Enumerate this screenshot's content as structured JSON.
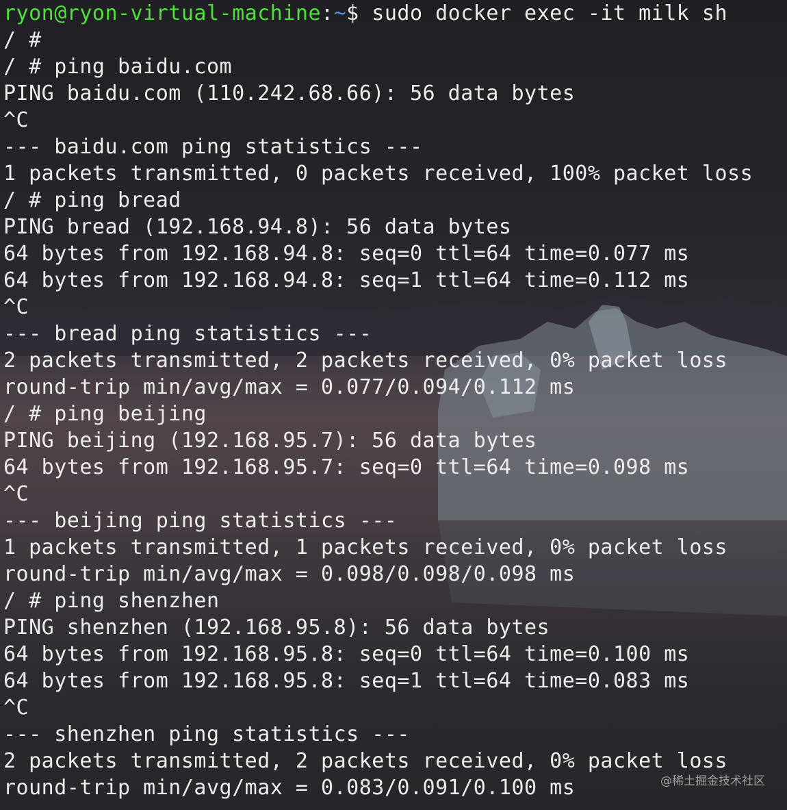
{
  "prompt": {
    "user_host": "ryon@ryon-virtual-machine",
    "separator": ":",
    "path": "~",
    "symbol": "$ ",
    "command": "sudo docker exec -it milk sh"
  },
  "lines": [
    "/ #",
    "/ # ping baidu.com",
    "PING baidu.com (110.242.68.66): 56 data bytes",
    "^C",
    "--- baidu.com ping statistics ---",
    "1 packets transmitted, 0 packets received, 100% packet loss",
    "/ # ping bread",
    "PING bread (192.168.94.8): 56 data bytes",
    "64 bytes from 192.168.94.8: seq=0 ttl=64 time=0.077 ms",
    "64 bytes from 192.168.94.8: seq=1 ttl=64 time=0.112 ms",
    "^C",
    "--- bread ping statistics ---",
    "2 packets transmitted, 2 packets received, 0% packet loss",
    "round-trip min/avg/max = 0.077/0.094/0.112 ms",
    "/ # ping beijing",
    "PING beijing (192.168.95.7): 56 data bytes",
    "64 bytes from 192.168.95.7: seq=0 ttl=64 time=0.098 ms",
    "^C",
    "--- beijing ping statistics ---",
    "1 packets transmitted, 1 packets received, 0% packet loss",
    "round-trip min/avg/max = 0.098/0.098/0.098 ms",
    "/ # ping shenzhen",
    "PING shenzhen (192.168.95.8): 56 data bytes",
    "64 bytes from 192.168.95.8: seq=0 ttl=64 time=0.100 ms",
    "64 bytes from 192.168.95.8: seq=1 ttl=64 time=0.083 ms",
    "^C",
    "--- shenzhen ping statistics ---",
    "2 packets transmitted, 2 packets received, 0% packet loss",
    "round-trip min/avg/max = 0.083/0.091/0.100 ms"
  ],
  "watermark": "@稀土掘金技术社区",
  "colors": {
    "text": "#ececec",
    "prompt_user": "#4fe03a",
    "prompt_path": "#4b8df0"
  }
}
